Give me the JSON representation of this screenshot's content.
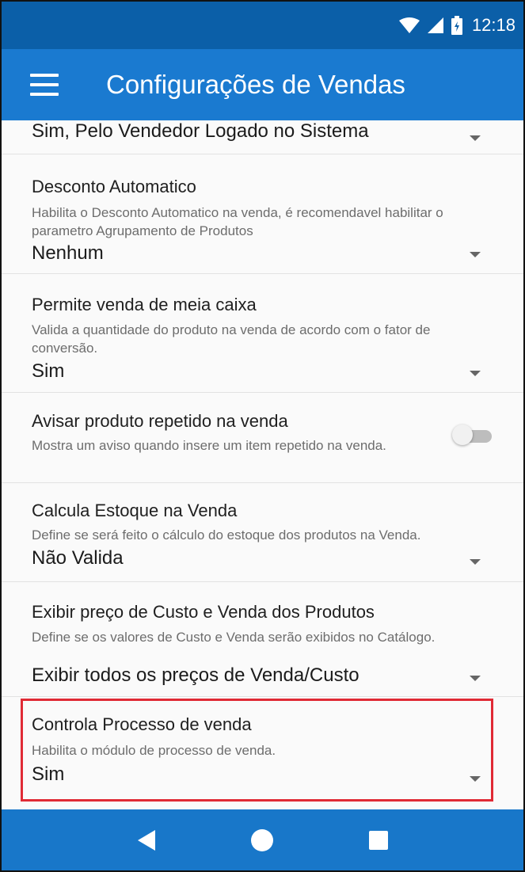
{
  "status": {
    "time": "12:18"
  },
  "appbar": {
    "title": "Configurações de Vendas"
  },
  "settings": [
    {
      "value": "Sim, Pelo Vendedor Logado no Sistema"
    },
    {
      "title": "Desconto Automatico",
      "description": "Habilita o Desconto Automatico na venda, é recomendavel habilitar o parametro Agrupamento de Produtos",
      "value": "Nenhum"
    },
    {
      "title": "Permite venda de meia caixa",
      "description": "Valida a quantidade do produto na venda de acordo com o fator de conversão.",
      "value": "Sim"
    },
    {
      "title": "Avisar produto repetido na venda",
      "description": "Mostra um aviso quando insere um item repetido na venda."
    },
    {
      "title": "Calcula Estoque na Venda",
      "description": "Define se será feito o cálculo do estoque dos produtos na Venda.",
      "value": "Não Valida"
    },
    {
      "title": "Exibir preço de Custo e Venda dos Produtos",
      "description": "Define se os valores de Custo e Venda serão exibidos no Catálogo.",
      "value": "Exibir todos os preços de Venda/Custo"
    },
    {
      "title": "Controla Processo de venda",
      "description": "Habilita o módulo de processo de venda.",
      "value": "Sim"
    }
  ],
  "toggle_state": "off",
  "colors": {
    "statusbar": "#0b5fa8",
    "appbar": "#1a7ad0",
    "navbar": "#1877c9",
    "highlight": "#e02a35"
  },
  "icons": [
    "wifi-icon",
    "signal-icon",
    "battery-icon",
    "menu-icon",
    "dropdown-caret-icon",
    "back-icon",
    "home-icon",
    "recents-icon"
  ]
}
